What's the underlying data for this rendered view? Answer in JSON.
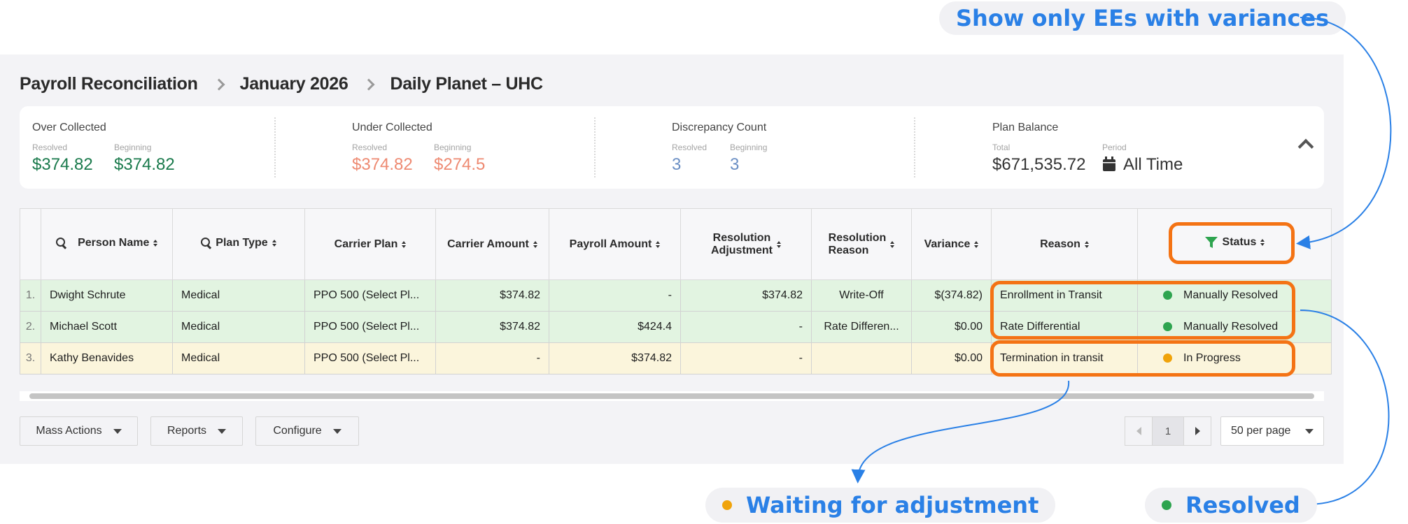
{
  "breadcrumb": {
    "items": [
      "Payroll Reconciliation",
      "January 2026",
      "Daily Planet – UHC"
    ]
  },
  "summary": {
    "over_collected": {
      "title": "Over Collected",
      "resolved_label": "Resolved",
      "resolved_value": "$374.82",
      "beginning_label": "Beginning",
      "beginning_value": "$374.82"
    },
    "under_collected": {
      "title": "Under Collected",
      "resolved_label": "Resolved",
      "resolved_value": "$374.82",
      "beginning_label": "Beginning",
      "beginning_value": "$274.5"
    },
    "discrepancy_count": {
      "title": "Discrepancy Count",
      "resolved_label": "Resolved",
      "resolved_value": "3",
      "beginning_label": "Beginning",
      "beginning_value": "3"
    },
    "plan_balance": {
      "title": "Plan Balance",
      "total_label": "Total",
      "total_value": "$671,535.72",
      "period_label": "Period",
      "period_value": "All Time"
    }
  },
  "table": {
    "headers": {
      "person_name": "Person Name",
      "plan_type": "Plan Type",
      "carrier_plan": "Carrier Plan",
      "carrier_amount": "Carrier Amount",
      "payroll_amount": "Payroll Amount",
      "resolution_adjustment_1": "Resolution",
      "resolution_adjustment_2": "Adjustment",
      "resolution_reason_1": "Resolution",
      "resolution_reason_2": "Reason",
      "variance": "Variance",
      "reason": "Reason",
      "status": "Status"
    },
    "rows": [
      {
        "num": "1.",
        "name": "Dwight Schrute",
        "plan_type": "Medical",
        "carrier_plan": "PPO 500 (Select Pl...",
        "carrier_amount": "$374.82",
        "payroll_amount": "-",
        "resolution_adjustment": "$374.82",
        "resolution_reason": "Write-Off",
        "variance": "$(374.82)",
        "reason": "Enrollment in Transit",
        "status": "Manually Resolved"
      },
      {
        "num": "2.",
        "name": "Michael Scott",
        "plan_type": "Medical",
        "carrier_plan": "PPO 500 (Select Pl...",
        "carrier_amount": "$374.82",
        "payroll_amount": "$424.4",
        "resolution_adjustment": "-",
        "resolution_reason": "Rate Differen...",
        "variance": "$0.00",
        "reason": "Rate Differential",
        "status": "Manually Resolved"
      },
      {
        "num": "3.",
        "name": "Kathy Benavides",
        "plan_type": "Medical",
        "carrier_plan": "PPO 500 (Select Pl...",
        "carrier_amount": "-",
        "payroll_amount": "$374.82",
        "resolution_adjustment": "-",
        "resolution_reason": "",
        "variance": "$0.00",
        "reason": "Termination in transit",
        "status": "In Progress"
      }
    ]
  },
  "footer": {
    "mass_actions": "Mass Actions",
    "reports": "Reports",
    "configure": "Configure",
    "page": "1",
    "per_page": "50 per page"
  },
  "annotations": {
    "filter_callout": "Show only EEs with variances",
    "waiting_callout": "Waiting for adjustment",
    "resolved_callout": "Resolved"
  },
  "colors": {
    "resolved_row": "#e2f4e1",
    "progress_row": "#fbf5dc",
    "highlight": "#f47314",
    "annotation_text": "#2a80e6",
    "status_green": "#2ea44f",
    "status_orange": "#f0a30a"
  },
  "icons": [
    "chevron-right-icon",
    "calendar-icon",
    "chevron-up-icon",
    "search-icon",
    "sort-icon",
    "filter-icon",
    "status-dot-icon",
    "caret-down-icon",
    "pager-prev-icon",
    "pager-next-icon"
  ]
}
